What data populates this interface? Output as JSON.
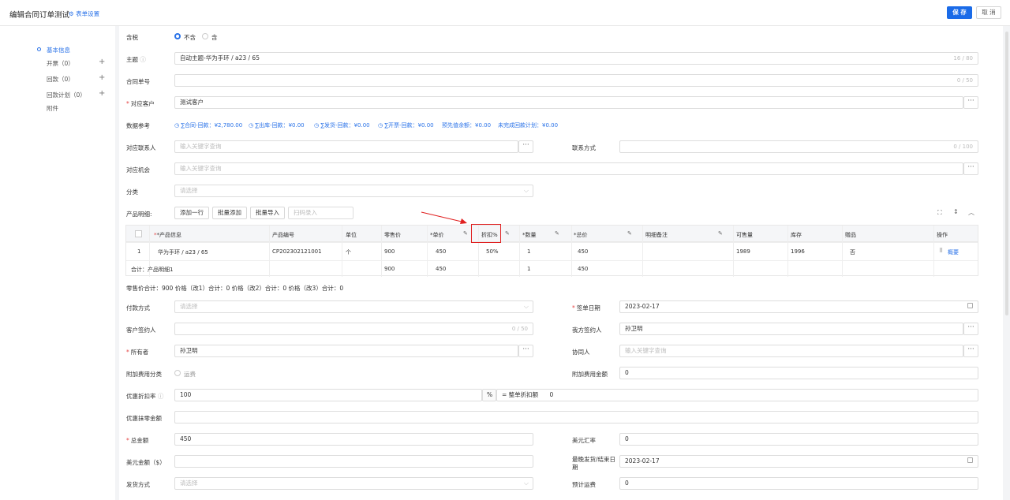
{
  "header": {
    "title": "编辑合同订单测试",
    "form_settings": "表单设置",
    "save": "保 存",
    "cancel": "取 消"
  },
  "sidebar": {
    "items": [
      {
        "label": "基本信息"
      },
      {
        "label": "开票（0）"
      },
      {
        "label": "回款（0）"
      },
      {
        "label": "回款计划（0）"
      },
      {
        "label": "附件"
      }
    ]
  },
  "form": {
    "tax": {
      "label": "含税",
      "opt1": "不含",
      "opt2": "含"
    },
    "subject": {
      "label": "主题",
      "value": "自动主题-华为手环 / a23 / 65",
      "count": "16 / 80"
    },
    "contract_no": {
      "label": "合同单号",
      "count": "0 / 50"
    },
    "customer": {
      "label": "对应客户",
      "value": "测试客户"
    },
    "data_ref": {
      "label": "数据参考",
      "items": [
        "∑合同-回款：¥2,780.00",
        "∑出库-回款：¥0.00",
        "∑发货-回款：¥0.00",
        "∑开票-回款：¥0.00",
        "预先值余额：¥0.00",
        "未完成回款计划：¥0.00"
      ]
    },
    "contact": {
      "label": "对应联系人",
      "placeholder": "输入关键字查询"
    },
    "contact_way": {
      "label": "联系方式",
      "count": "0 / 100"
    },
    "opportunity": {
      "label": "对应机会",
      "placeholder": "输入关键字查询"
    },
    "category": {
      "label": "分类",
      "placeholder": "请选择"
    },
    "products": {
      "label": "产品明细:",
      "add_row": "添加一行",
      "batch_add": "批量添加",
      "batch_import": "批量导入",
      "scan": "扫码录入"
    },
    "table": {
      "headers": [
        "*产品信息",
        "产品编号",
        "单位",
        "零售价",
        "*单价",
        "折扣%",
        "*数量",
        "*总价",
        "明细备注",
        "可售量",
        "库存",
        "赠品",
        "操作"
      ],
      "row": {
        "idx": "1",
        "product": "华为手环 / a23 / 65",
        "code": "CP202302121001",
        "unit": "个",
        "retail": "900",
        "price": "450",
        "discount": "50%",
        "qty": "1",
        "total": "450",
        "sellable": "1989",
        "stock": "1996",
        "gift": "否",
        "op": "概要"
      },
      "sum": {
        "label": "合计：产品明细1",
        "retail": "900",
        "price": "450",
        "qty": "1",
        "total": "450"
      }
    },
    "summary_line": "零售价合计：900  价格（改1）合计：0  价格（改2）合计：0  价格（改3）合计：0",
    "payment": {
      "label": "付款方式",
      "placeholder": "请选择"
    },
    "sign_date": {
      "label": "签单日期",
      "value": "2023-02-17"
    },
    "cust_signer": {
      "label": "客户签约人",
      "count": "0 / 50"
    },
    "our_signer": {
      "label": "我方签约人",
      "value": "孙卫明"
    },
    "owner": {
      "label": "所有者",
      "value": "孙卫明"
    },
    "collaborator": {
      "label": "协同人",
      "placeholder": "输入关键字查询"
    },
    "extra_fee_cat": {
      "label": "附加费用分类",
      "opt": "运费"
    },
    "extra_fee_amt": {
      "label": "附加费用金额",
      "value": "0"
    },
    "discount_rate": {
      "label": "优惠折扣率",
      "value": "100",
      "unit": "%",
      "eq": "= 整单折扣额",
      "eq_val": "0"
    },
    "rounding": {
      "label": "优惠抹零金额"
    },
    "total": {
      "label": "总金额",
      "value": "450"
    },
    "usd_rate": {
      "label": "美元汇率",
      "value": "0"
    },
    "usd_amount": {
      "label": "美元金额（$）"
    },
    "latest_ship": {
      "label1": "最晚发货/结束日",
      "label2": "期",
      "value": "2023-02-17"
    },
    "ship_way": {
      "label": "发货方式",
      "placeholder": "请选择"
    },
    "est_freight": {
      "label": "预计运费",
      "value": "0"
    }
  }
}
